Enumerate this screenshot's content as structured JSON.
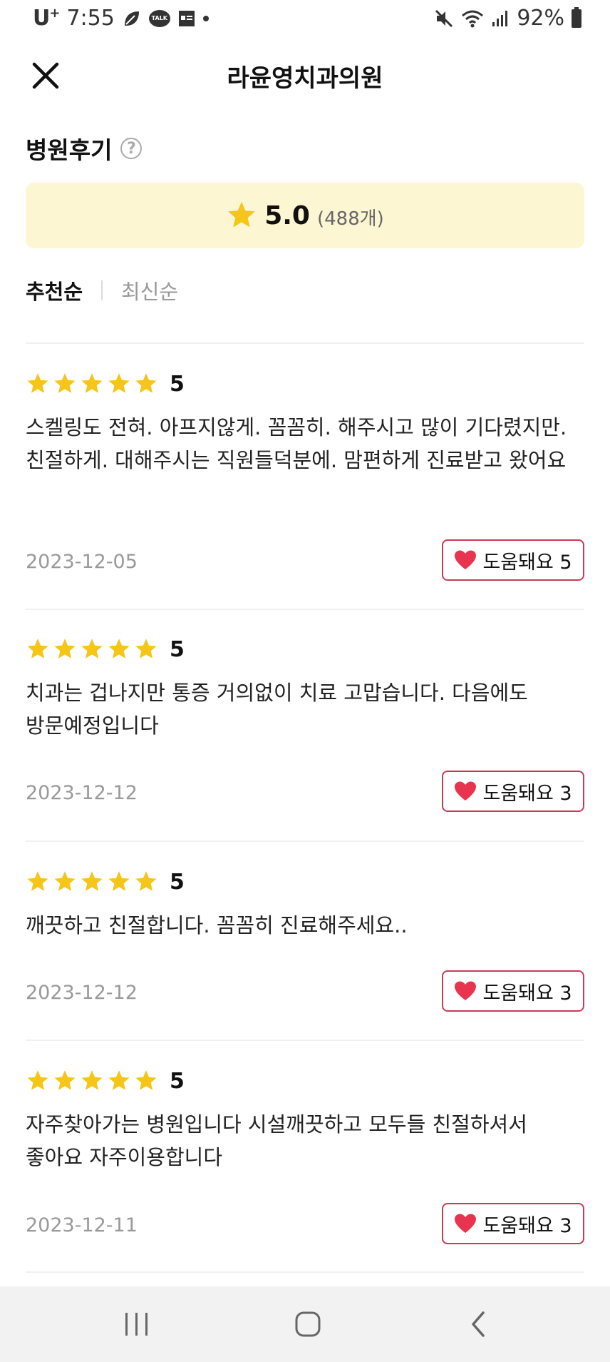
{
  "status_bar": {
    "carrier": "U",
    "carrier_sup": "+",
    "time": "7:55",
    "talk_label": "TALK",
    "battery": "92%"
  },
  "header": {
    "title": "라윤영치과의원",
    "close_icon": "close-icon"
  },
  "section": {
    "title": "병원후기",
    "help_icon": "?"
  },
  "rating": {
    "score": "5.0",
    "count": "(488개)",
    "star_color": "#f5c518"
  },
  "sort": {
    "active": "추천순",
    "inactive": "최신순"
  },
  "reviews": [
    {
      "stars": 5,
      "score": "5",
      "text": "스켈링도 전혀. 아프지않게. 꼼꼼히. 해주시고 많이 기다렸지만. 친절하게. 대해주시는 직원들덕분에. 맘편하게 진료받고 왔어요",
      "date": "2023-12-05",
      "helpful": "도움돼요 5"
    },
    {
      "stars": 5,
      "score": "5",
      "text": "치과는 겁나지만 통증 거의없이 치료 고맙습니다. 다음에도 방문예정입니다",
      "date": "2023-12-12",
      "helpful": "도움돼요 3"
    },
    {
      "stars": 5,
      "score": "5",
      "text": "깨끗하고 친절합니다. 꼼꼼히 진료해주세요..",
      "date": "2023-12-12",
      "helpful": "도움돼요 3"
    },
    {
      "stars": 5,
      "score": "5",
      "text": "자주찾아가는 병원입니다 시설깨끗하고 모두들 친절하셔서 좋아요 자주이용합니다",
      "date": "2023-12-11",
      "helpful": "도움돼요 3"
    }
  ],
  "colors": {
    "accent": "#c93b54",
    "heart": "#e8344e",
    "rating_bg": "#fdf6d3"
  }
}
